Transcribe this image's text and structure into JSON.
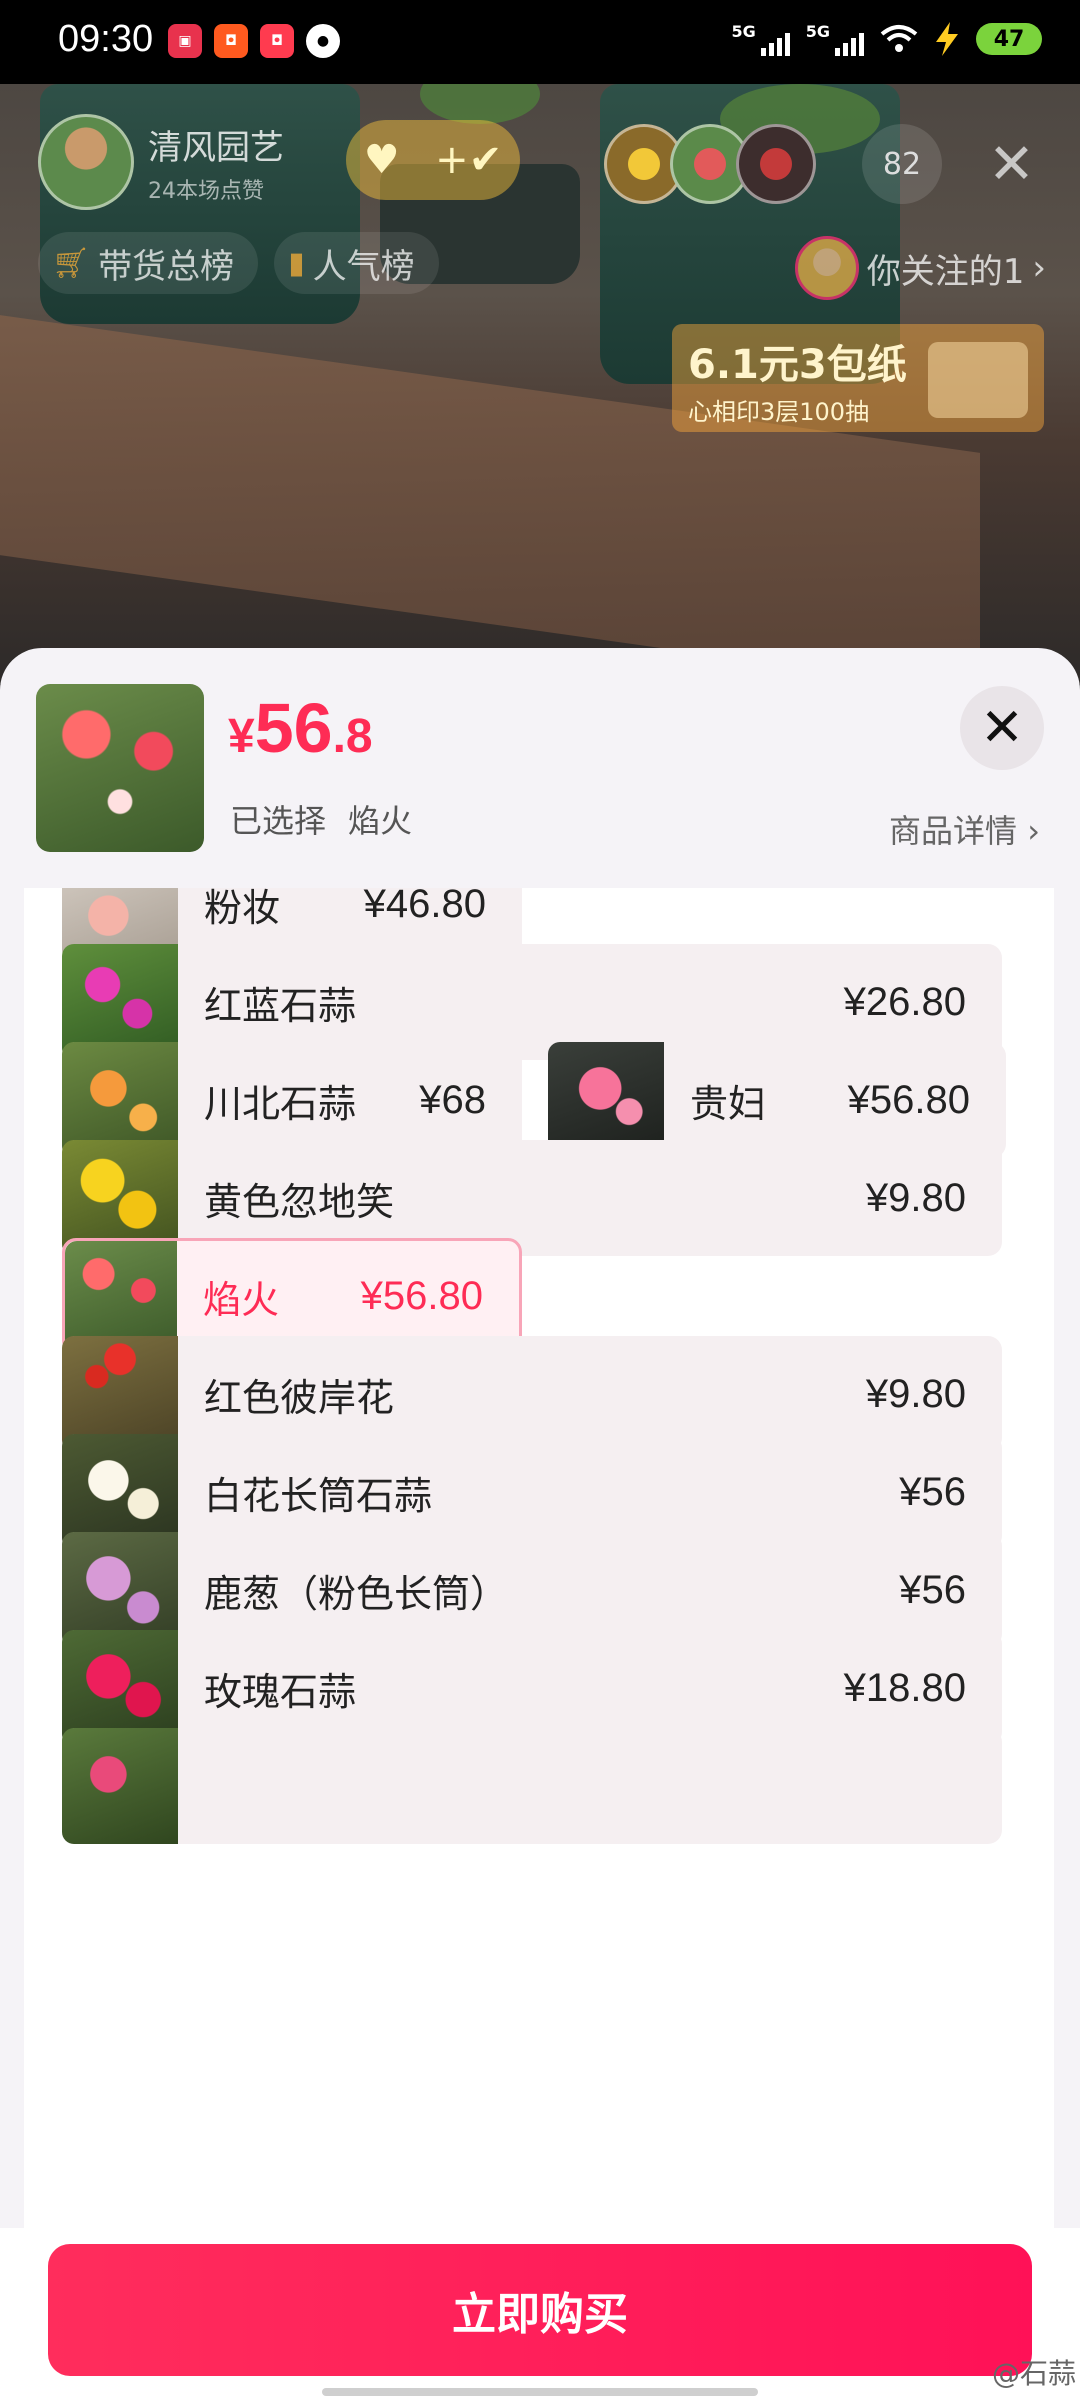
{
  "status_bar": {
    "time": "09:30",
    "net1": "5G",
    "net2": "5G",
    "battery": "47"
  },
  "live": {
    "host_name": "清风园艺",
    "host_likes": "24本场点赞",
    "viewer_count": "82",
    "rank_sales": "带货总榜",
    "rank_popular": "人气榜",
    "following": "你关注的1",
    "promo_title": "6.1元3包纸",
    "promo_sub": "心相印3层100抽"
  },
  "sheet": {
    "currency": "¥",
    "price_int": "56",
    "price_dec": ".8",
    "selected_label": "已选择",
    "selected_value": "焰火",
    "detail_link": "商品详情",
    "options": [
      {
        "name": "粉妆",
        "price": "¥46.80"
      },
      {
        "name": "红蓝石蒜",
        "price": "¥26.80"
      },
      {
        "name": "川北石蒜",
        "price": "¥68"
      },
      {
        "name": "贵妇",
        "price": "¥56.80"
      },
      {
        "name": "黄色忽地笑",
        "price": "¥9.80"
      },
      {
        "name": "焰火",
        "price": "¥56.80"
      },
      {
        "name": "红色彼岸花",
        "price": "¥9.80"
      },
      {
        "name": "白花长筒石蒜",
        "price": "¥56"
      },
      {
        "name": "鹿葱（粉色长筒）",
        "price": "¥56"
      },
      {
        "name": "玫瑰石蒜",
        "price": "¥18.80"
      }
    ],
    "buy_button": "立即购买",
    "watermark": "@石蒜"
  },
  "colors": {
    "accent": "#fe2c55",
    "option_bg": "#f5eff1",
    "selected_border": "#f8a5b8"
  }
}
